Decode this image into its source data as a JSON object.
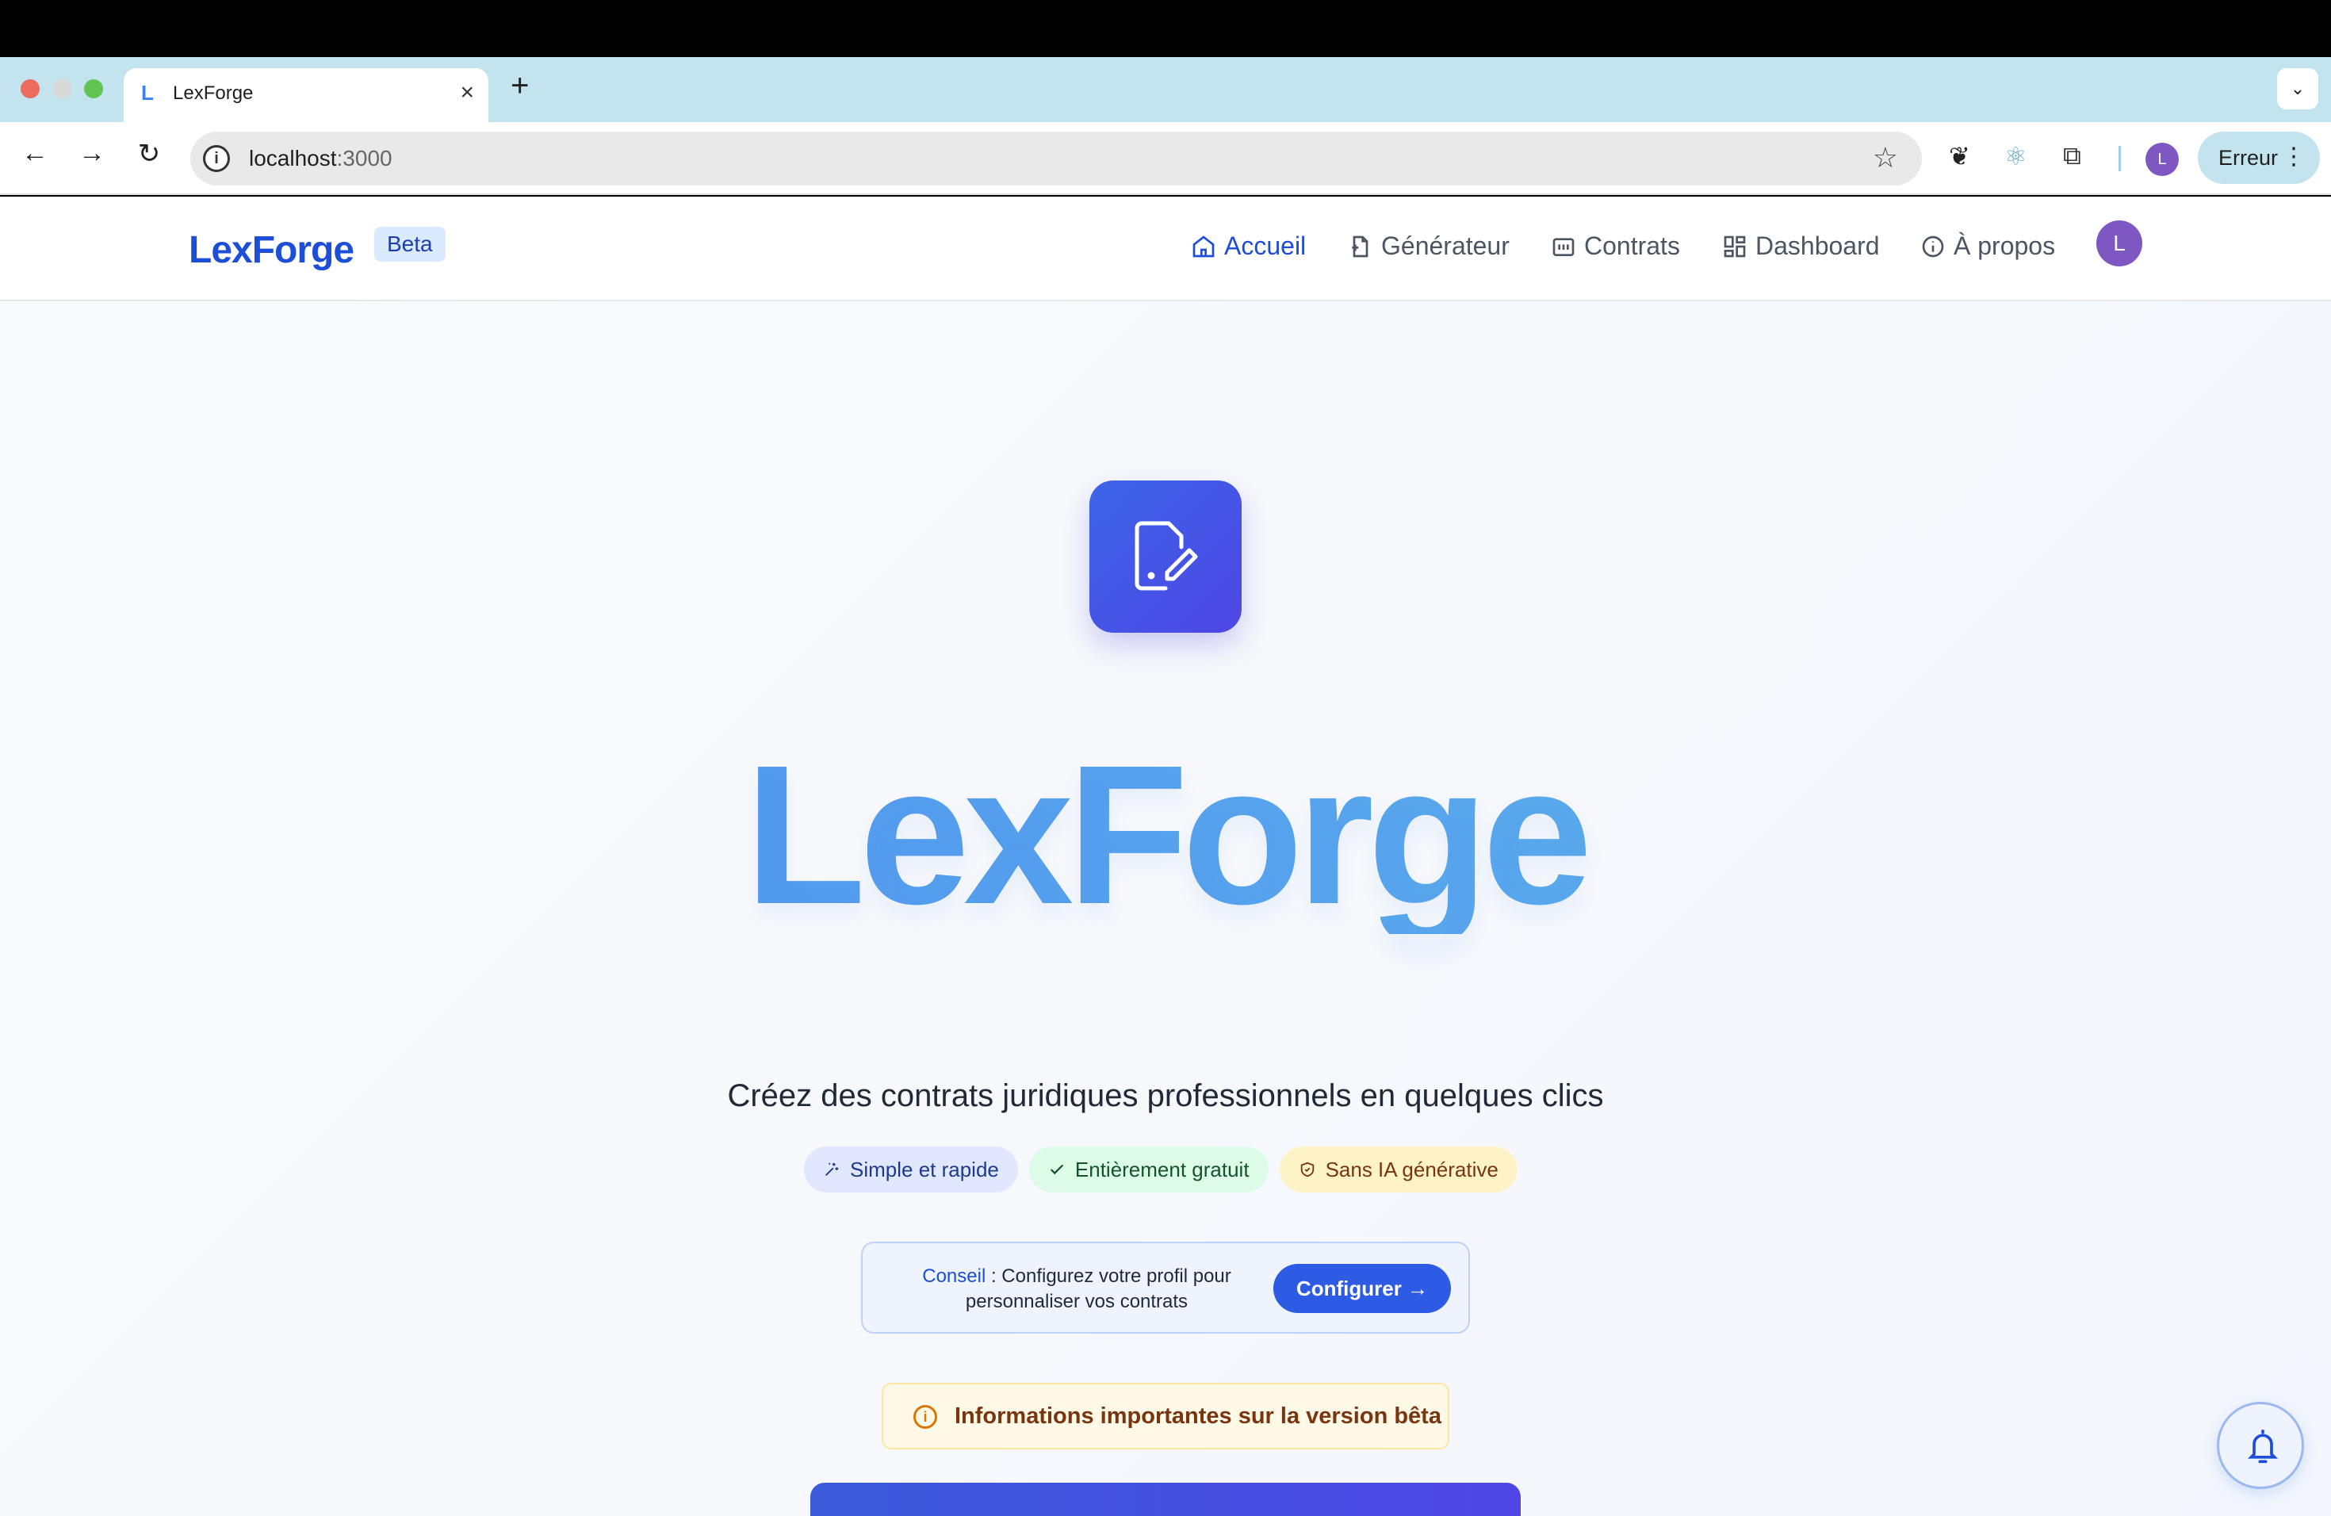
{
  "browser": {
    "tab_favicon": "L",
    "tab_title": "LexForge",
    "tab_close": "×",
    "new_tab": "+",
    "tab_menu": "⌄",
    "url_host": "localhost",
    "url_port": ":3000",
    "profile_initial": "L",
    "error_label": "Erreur"
  },
  "header": {
    "brand": "LexForge",
    "badge": "Beta",
    "nav": [
      {
        "label": "Accueil",
        "icon": "home-icon"
      },
      {
        "label": "Générateur",
        "icon": "file-plus-icon"
      },
      {
        "label": "Contrats",
        "icon": "folder-icon"
      },
      {
        "label": "Dashboard",
        "icon": "grid-icon"
      },
      {
        "label": "À propos",
        "icon": "info-icon"
      }
    ],
    "user_initial": "L"
  },
  "hero": {
    "icon": "document-edit-icon",
    "title": "LexForge",
    "subtitle": "Créez des contrats juridiques professionnels en quelques clics",
    "badges": [
      {
        "label": "Simple et rapide",
        "icon": "sparkle-icon"
      },
      {
        "label": "Entièrement gratuit",
        "icon": "check-icon"
      },
      {
        "label": "Sans IA générative",
        "icon": "shield-icon"
      }
    ]
  },
  "tip": {
    "label": "Conseil",
    "text": " : Configurez votre profil pour personnaliser vos contrats",
    "button": "Configurer →"
  },
  "beta_notice": {
    "text": "Informations importantes sur la version bêta"
  },
  "colors": {
    "brand": "#1d4ed8",
    "accent": "#4f46e5",
    "tab_strip": "#c3e3ef"
  }
}
